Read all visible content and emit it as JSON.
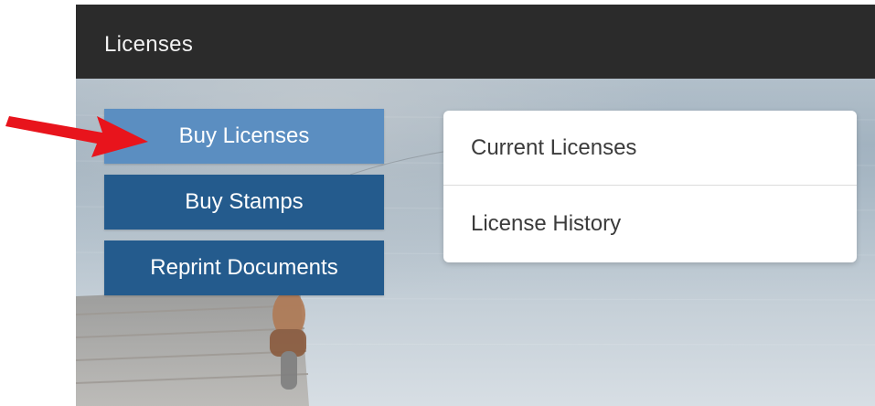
{
  "header": {
    "title": "Licenses"
  },
  "sidebar": {
    "items": [
      {
        "label": "Buy Licenses",
        "active": true
      },
      {
        "label": "Buy Stamps",
        "active": false
      },
      {
        "label": "Reprint Documents",
        "active": false
      }
    ]
  },
  "menu": {
    "items": [
      {
        "label": "Current Licenses"
      },
      {
        "label": "License History"
      }
    ]
  },
  "colors": {
    "header_bg": "#2b2b2b",
    "active_button": "#5b8ec1",
    "button": "#245b8d",
    "annotation_arrow": "#e8141c"
  },
  "icons": {
    "pointer": "red-arrow-icon"
  }
}
